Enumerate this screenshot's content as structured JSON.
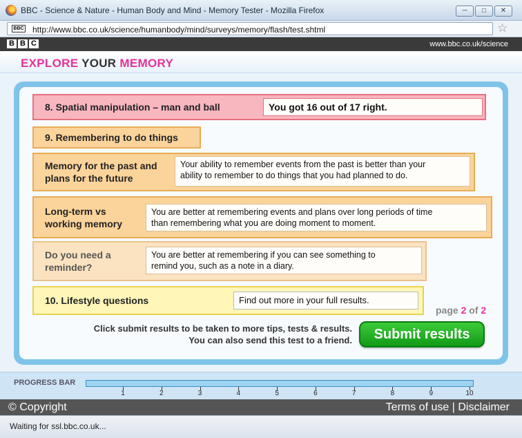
{
  "window": {
    "title": "BBC - Science & Nature - Human Body and Mind - Memory Tester - Mozilla Firefox",
    "min_symbol": "─",
    "max_symbol": "□",
    "close_symbol": "✕"
  },
  "browser": {
    "url": "http://www.bbc.co.uk/science/humanbody/mind/surveys/memory/flash/test.shtml",
    "site_icon": "BBC",
    "bookmark_star": "☆"
  },
  "bbc_header": {
    "logo_letters": [
      "B",
      "B",
      "C"
    ],
    "site": "www.bbc.co.uk/science"
  },
  "page": {
    "heading_part1": "EXPLORE",
    "heading_part2": "YOUR",
    "heading_part3": "MEMORY"
  },
  "results": [
    {
      "label": "8. Spatial manipulation  – man and ball",
      "message": "You got 16 out of 17 right."
    },
    {
      "label": "9. Remembering to do things",
      "message": ""
    },
    {
      "label_line1": "Memory for the past and",
      "label_line2": "plans for the future",
      "message_line1": "Your ability to remember events from the past is better than your",
      "message_line2": "ability to remember to do things that you had planned to do."
    },
    {
      "label_line1": "Long-term vs",
      "label_line2": "working memory",
      "message_line1": "You are better at remembering events and plans over long periods of time",
      "message_line2": "than remembering what you are doing moment to moment."
    },
    {
      "label_line1": "Do you need a",
      "label_line2": "reminder?",
      "message_line1": "You are better at remembering if you can see something to",
      "message_line2": "remind you, such as a note in a diary."
    },
    {
      "label": "10. Lifestyle questions",
      "message": "Find out more in your full results."
    }
  ],
  "pagination": {
    "prefix": "page",
    "current": "2",
    "sep": "of",
    "total": "2"
  },
  "submit": {
    "instruction_line1": "Click submit results to be taken to more tips, tests & results.",
    "instruction_line2": "You can also send this test to a friend.",
    "button_label": "Submit results"
  },
  "progress": {
    "label": "PROGRESS BAR",
    "ticks": [
      "1",
      "2",
      "3",
      "4",
      "5",
      "6",
      "7",
      "8",
      "9",
      "10"
    ],
    "value": 0
  },
  "footer": {
    "copyright": "© Copyright",
    "terms": "Terms of use",
    "separator": "|",
    "disclaimer": "Disclaimer"
  },
  "status_text": "Waiting for ssl.bbc.co.uk..."
}
